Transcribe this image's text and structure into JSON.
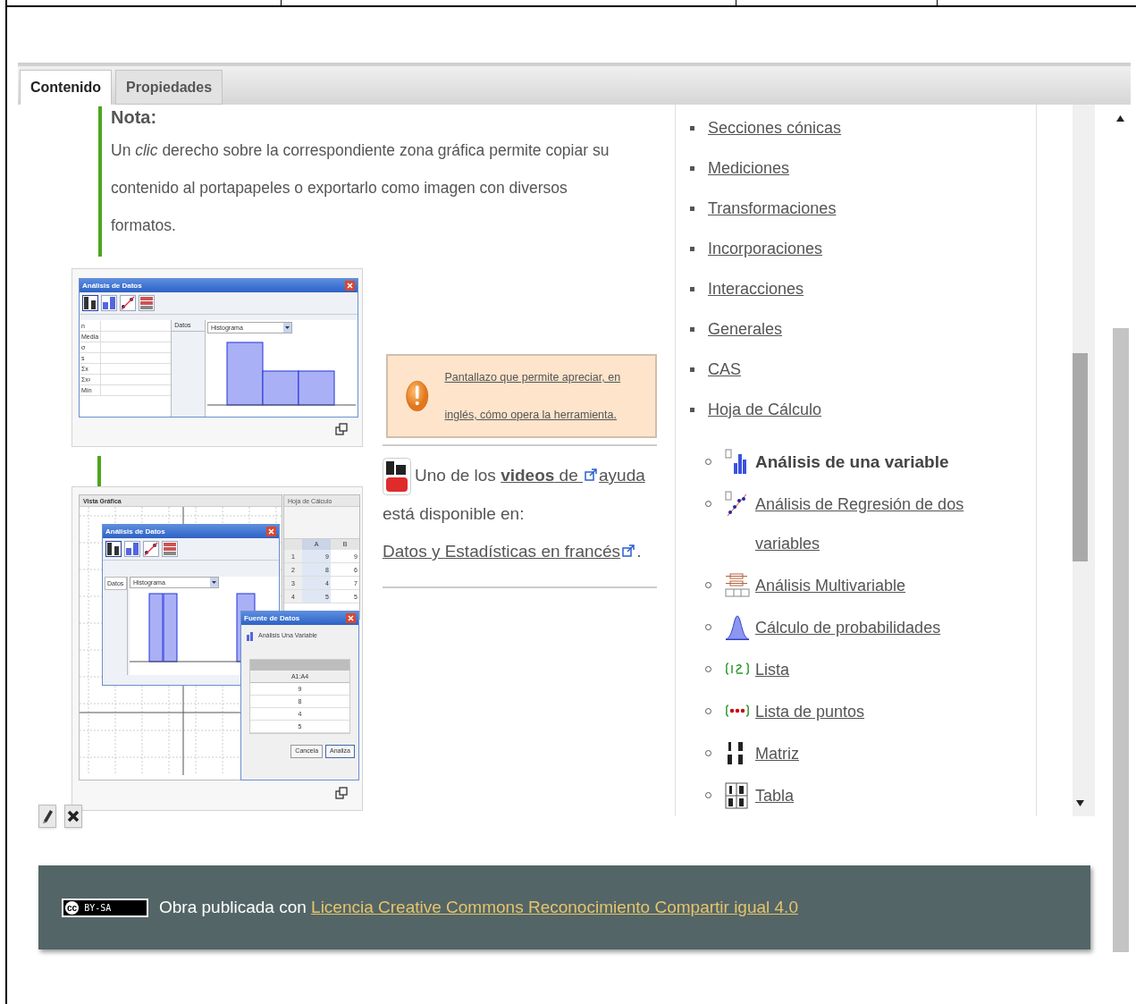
{
  "tabs": [
    {
      "label": "Contenido",
      "selected": true
    },
    {
      "label": "Propiedades",
      "selected": false
    }
  ],
  "note": {
    "heading": "Nota:",
    "text": "Un *clic* derecho sobre la correspondiente zona gráfica permite copiar su contenido al portapapeles o exportarlo como imagen con diversos formatos."
  },
  "screenshot_1": {
    "window_title": "Análisis de Datos",
    "stats_labels": [
      "n",
      "Media",
      "σ",
      "s",
      "Σx",
      "Σx²",
      "Mín"
    ],
    "data_header": "Datos",
    "chart_type": "Histograma"
  },
  "screenshot_2": {
    "view_title": "Vista Gráfica",
    "sheet_title": "Hoja de Cálculo",
    "window_title": "Análisis de Datos",
    "data_header": "Datos",
    "chart_type": "Histograma",
    "sheet_columns": [
      "A",
      "B"
    ],
    "sheet_rows": [
      {
        "row": "1",
        "cells": [
          "9",
          "9"
        ]
      },
      {
        "row": "2",
        "cells": [
          "8",
          "6"
        ]
      },
      {
        "row": "3",
        "cells": [
          "4",
          "7"
        ]
      },
      {
        "row": "4",
        "cells": [
          "5",
          "5"
        ]
      }
    ],
    "dialog": {
      "title": "Fuente de Datos",
      "mode": "Análisis Una Variable",
      "range": "A1:A4",
      "values": [
        "9",
        "8",
        "4",
        "5"
      ],
      "buttons": [
        "Cancela",
        "Analiza"
      ]
    }
  },
  "callout": {
    "text": "Pantallazo que permite apreciar, en inglés, cómo opera la herramienta."
  },
  "video_note": {
    "segments": [
      {
        "kind": "text",
        "text": "Uno de los "
      },
      {
        "kind": "link",
        "text": "**videos** de "
      },
      {
        "kind": "iconlink",
        "text": "ayuda"
      },
      {
        "kind": "text",
        "text": " está disponible en: "
      },
      {
        "kind": "linkicon",
        "text": "Datos y Estadísticas en francés"
      },
      {
        "kind": "text",
        "text": "."
      }
    ]
  },
  "topics": [
    "Secciones cónicas",
    "Mediciones",
    "Transformaciones",
    "Incorporaciones",
    "Interacciones",
    "Generales",
    "CAS",
    "Hoja de Cálculo"
  ],
  "tools": [
    {
      "label": "Análisis de una variable",
      "current": true
    },
    {
      "label": "Análisis de Regresión de dos variables",
      "current": false
    },
    {
      "label": "Análisis Multivariable",
      "current": false
    },
    {
      "label": "Cálculo de probabilidades",
      "current": false
    },
    {
      "label": "Lista",
      "current": false
    },
    {
      "label": "Lista de puntos",
      "current": false
    },
    {
      "label": "Matriz",
      "current": false
    },
    {
      "label": "Tabla",
      "current": false
    }
  ],
  "footer": {
    "license_symbol": "cc",
    "license_badge": "BY-SA",
    "text": "Obra publicada con",
    "link": "Licencia Creative Commons Reconocimiento Compartir igual 4.0"
  }
}
